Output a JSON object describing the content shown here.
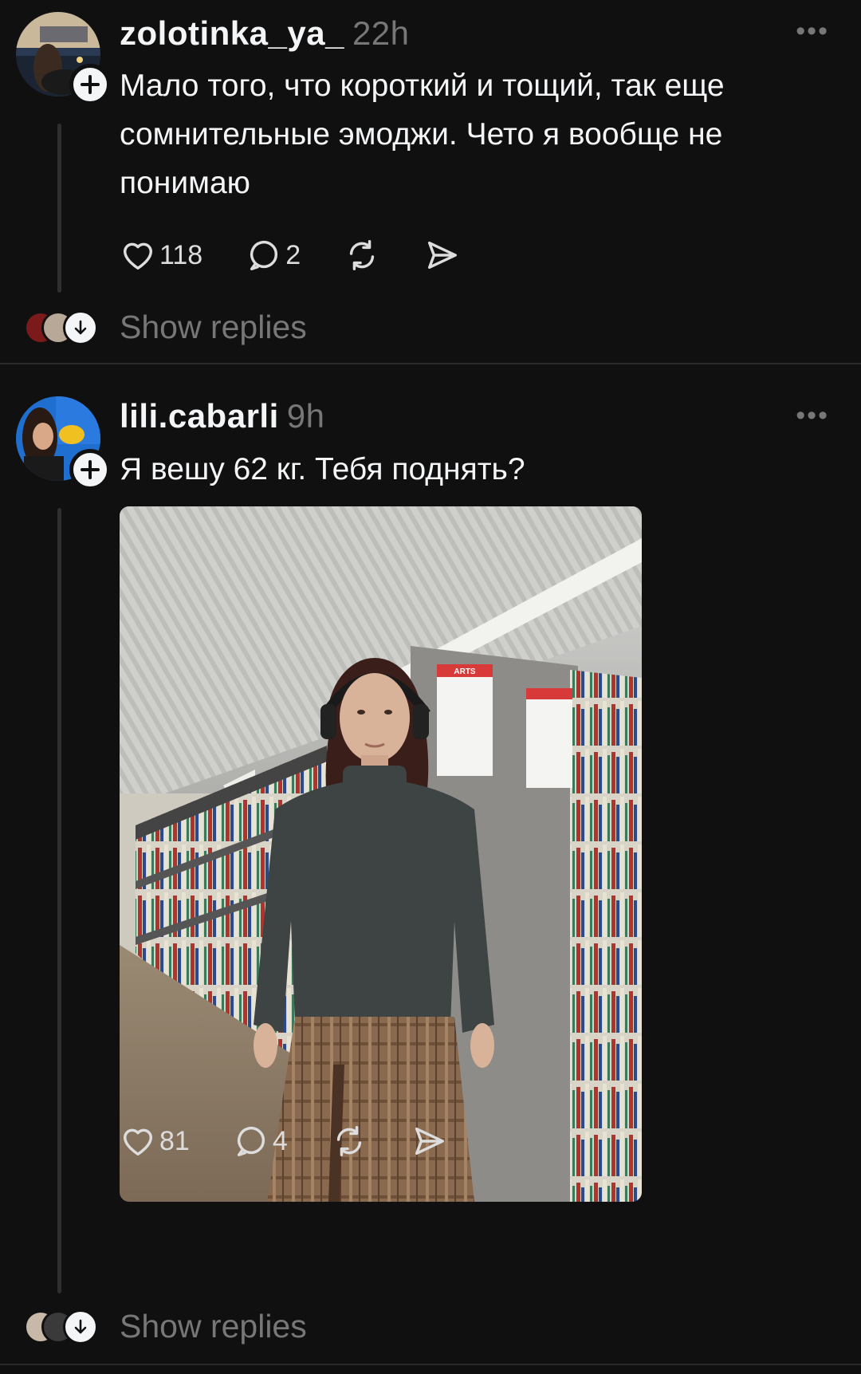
{
  "posts": [
    {
      "username": "zolotinka_ya_",
      "time": "22h",
      "text_lines": [
        "Мало того, что короткий и тощий,  так еще",
        "сомнительные эмоджи. Чето я вообще не",
        "понимаю"
      ],
      "likes": "118",
      "comments": "2",
      "show_replies": "Show replies"
    },
    {
      "username": "lili.cabarli",
      "time": "9h",
      "text_lines": [
        "Я вешу 62 кг. Тебя поднять?"
      ],
      "likes": "81",
      "comments": "4",
      "show_replies": "Show replies",
      "image": {
        "sign_title": "ARTS",
        "description": "Woman in grey sweater and plaid skirt with headphones standing in a library aisle"
      }
    }
  ],
  "icons": {
    "more": "more-icon",
    "like": "heart-icon",
    "comment": "comment-icon",
    "repost": "repost-icon",
    "share": "share-icon"
  }
}
